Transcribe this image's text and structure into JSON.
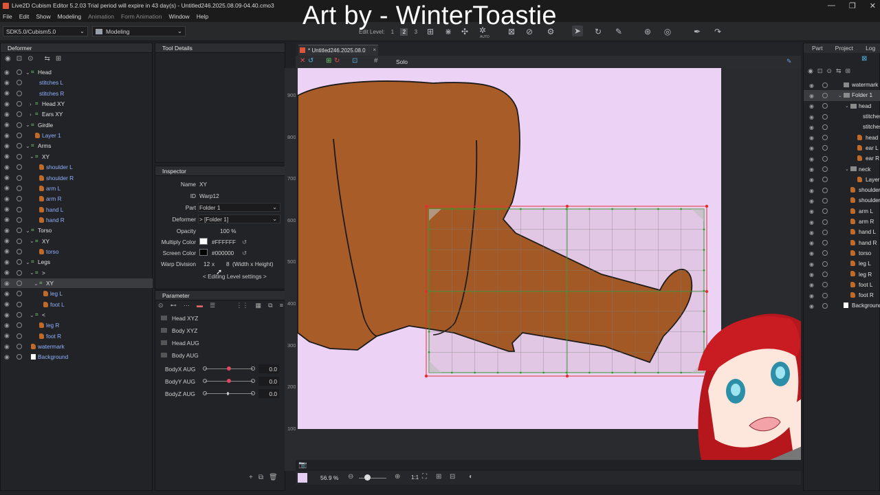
{
  "window": {
    "title": "Live2D Cubism Editor 5.2.03   Trial period will expire in 43 day(s)  - Untitled246.2025.08.09-04.40.cmo3",
    "controls": [
      "—",
      "❐",
      "✕"
    ]
  },
  "overlay_title": "Art by - WinterToastie",
  "menu": {
    "items": [
      "File",
      "Edit",
      "Show",
      "Modeling"
    ],
    "dim_items": [
      "Animation",
      "Form Animation"
    ],
    "items2": [
      "Window",
      "Help"
    ]
  },
  "toolbar": {
    "sdk_select": "SDK5.0/Cubism5.0",
    "mode_select": "Modeling",
    "edit_level_label": "Edit Level:",
    "edit_levels": [
      "1",
      "2",
      "3"
    ],
    "auto_label": "AUTO"
  },
  "deformer_panel": {
    "title": "Deformer",
    "rows": [
      {
        "label": "Head",
        "type": "warp",
        "indent": 1,
        "color": "white",
        "expand": "v"
      },
      {
        "label": "stitches L",
        "type": "none",
        "indent": 3,
        "color": "blue"
      },
      {
        "label": "stitches R",
        "type": "none",
        "indent": 3,
        "color": "blue"
      },
      {
        "label": "Head XY",
        "type": "warp",
        "indent": 2,
        "color": "white",
        "expand": ">"
      },
      {
        "label": "Ears XY",
        "type": "warp",
        "indent": 2,
        "color": "white",
        "expand": ">"
      },
      {
        "label": "Girdle",
        "type": "warp",
        "indent": 1,
        "color": "white",
        "expand": "v"
      },
      {
        "label": "Layer 1",
        "type": "art",
        "indent": 2,
        "color": "blue"
      },
      {
        "label": "Arms",
        "type": "warp",
        "indent": 1,
        "color": "white",
        "expand": "v"
      },
      {
        "label": "XY",
        "type": "warp",
        "indent": 2,
        "color": "white",
        "expand": "v"
      },
      {
        "label": "shoulder L",
        "type": "art",
        "indent": 3,
        "color": "blue"
      },
      {
        "label": "shoulder R",
        "type": "art",
        "indent": 3,
        "color": "blue"
      },
      {
        "label": "arm L",
        "type": "art",
        "indent": 3,
        "color": "blue"
      },
      {
        "label": "arm R",
        "type": "art",
        "indent": 3,
        "color": "blue"
      },
      {
        "label": "hand L",
        "type": "art",
        "indent": 3,
        "color": "blue"
      },
      {
        "label": "hand R",
        "type": "art",
        "indent": 3,
        "color": "blue"
      },
      {
        "label": "Torso",
        "type": "warp",
        "indent": 1,
        "color": "white",
        "expand": "v"
      },
      {
        "label": "XY",
        "type": "warp",
        "indent": 2,
        "color": "white",
        "expand": "v"
      },
      {
        "label": "torso",
        "type": "art",
        "indent": 3,
        "color": "blue"
      },
      {
        "label": "Legs",
        "type": "warp",
        "indent": 1,
        "color": "white",
        "expand": "v"
      },
      {
        "label": ">",
        "type": "warp",
        "indent": 2,
        "color": "white",
        "expand": "v"
      },
      {
        "label": "XY",
        "type": "warp",
        "indent": 3,
        "color": "white",
        "expand": "v",
        "selected": true
      },
      {
        "label": "leg L",
        "type": "art",
        "indent": 4,
        "color": "blue"
      },
      {
        "label": "foot L",
        "type": "art",
        "indent": 4,
        "color": "blue"
      },
      {
        "label": "<",
        "type": "warp",
        "indent": 2,
        "color": "white",
        "expand": "v"
      },
      {
        "label": "leg R",
        "type": "art",
        "indent": 3,
        "color": "blue"
      },
      {
        "label": "foot R",
        "type": "art",
        "indent": 3,
        "color": "blue"
      },
      {
        "label": "watermark",
        "type": "art",
        "indent": 1,
        "color": "blue"
      },
      {
        "label": "Background",
        "type": "white",
        "indent": 1,
        "color": "blue"
      }
    ]
  },
  "tool_details": {
    "title": "Tool Details"
  },
  "inspector": {
    "title": "Inspector",
    "name_label": "Name",
    "name_value": "XY",
    "id_label": "ID",
    "id_value": "Warp12",
    "part_label": "Part",
    "part_value": "Folder 1",
    "deformer_label": "Deformer",
    "deformer_value": ">  [Folder 1]",
    "opacity_label": "Opacity",
    "opacity_value": "100 %",
    "multiply_label": "Multiply Color",
    "multiply_value": "#FFFFFF",
    "multiply_swatch": "#ffffff",
    "screen_label": "Screen Color",
    "screen_value": "#000000",
    "screen_swatch": "#000000",
    "warp_label": "Warp Division",
    "warp_w": "12",
    "warp_x": "x",
    "warp_h": "8",
    "warp_note": "(Width x Height)",
    "editing_level": "< Editing Level settings >"
  },
  "parameter": {
    "title": "Parameter",
    "folders": [
      "Head XYZ",
      "Body XYZ",
      "Head AUG",
      "Body AUG"
    ],
    "sliders": [
      {
        "label": "BodyX AUG",
        "value": "0.0",
        "fraction": 0.5,
        "keyed": true
      },
      {
        "label": "BodyY AUG",
        "value": "0.0",
        "fraction": 0.5,
        "keyed": true
      },
      {
        "label": "BodyZ AUG",
        "value": "0.0",
        "fraction": 0.5,
        "keyed": false
      }
    ]
  },
  "canvas": {
    "tab_label": "* Untitled246.2025.08.0",
    "solo_label": "Solo",
    "ruler": [
      "900",
      "800",
      "700",
      "600",
      "500",
      "400",
      "300",
      "200",
      "100"
    ],
    "zoom": "56.9 %",
    "ratio": "1:1"
  },
  "right_panel": {
    "tabs": [
      "Part",
      "Project",
      "Log"
    ],
    "rows": [
      {
        "label": "watermark",
        "indent": 0,
        "type": "layer"
      },
      {
        "label": "Folder 1",
        "indent": 0,
        "type": "folder",
        "selected": true
      },
      {
        "label": "head",
        "indent": 1,
        "type": "folder"
      },
      {
        "label": "stitches",
        "indent": 2,
        "type": "none"
      },
      {
        "label": "stitches",
        "indent": 2,
        "type": "none"
      },
      {
        "label": "head",
        "indent": 2,
        "type": "art"
      },
      {
        "label": "ear L",
        "indent": 2,
        "type": "art"
      },
      {
        "label": "ear R",
        "indent": 2,
        "type": "art"
      },
      {
        "label": "neck",
        "indent": 1,
        "type": "folder"
      },
      {
        "label": "Layer 1",
        "indent": 2,
        "type": "art"
      },
      {
        "label": "shoulder",
        "indent": 1,
        "type": "art"
      },
      {
        "label": "shoulder",
        "indent": 1,
        "type": "art"
      },
      {
        "label": "arm L",
        "indent": 1,
        "type": "art"
      },
      {
        "label": "arm R",
        "indent": 1,
        "type": "art"
      },
      {
        "label": "hand L",
        "indent": 1,
        "type": "art"
      },
      {
        "label": "hand R",
        "indent": 1,
        "type": "art"
      },
      {
        "label": "torso",
        "indent": 1,
        "type": "art"
      },
      {
        "label": "leg L",
        "indent": 1,
        "type": "art"
      },
      {
        "label": "leg R",
        "indent": 1,
        "type": "art"
      },
      {
        "label": "foot L",
        "indent": 1,
        "type": "art"
      },
      {
        "label": "foot R",
        "indent": 1,
        "type": "art"
      },
      {
        "label": "Background",
        "indent": 0,
        "type": "white"
      }
    ]
  },
  "colors": {
    "canvas_bg": "#ecd3f6",
    "leg_fill": "#a85c28",
    "warp_line": "#2e9b2e",
    "bbox_red": "#e03030",
    "accent_red": "#e0553a"
  }
}
